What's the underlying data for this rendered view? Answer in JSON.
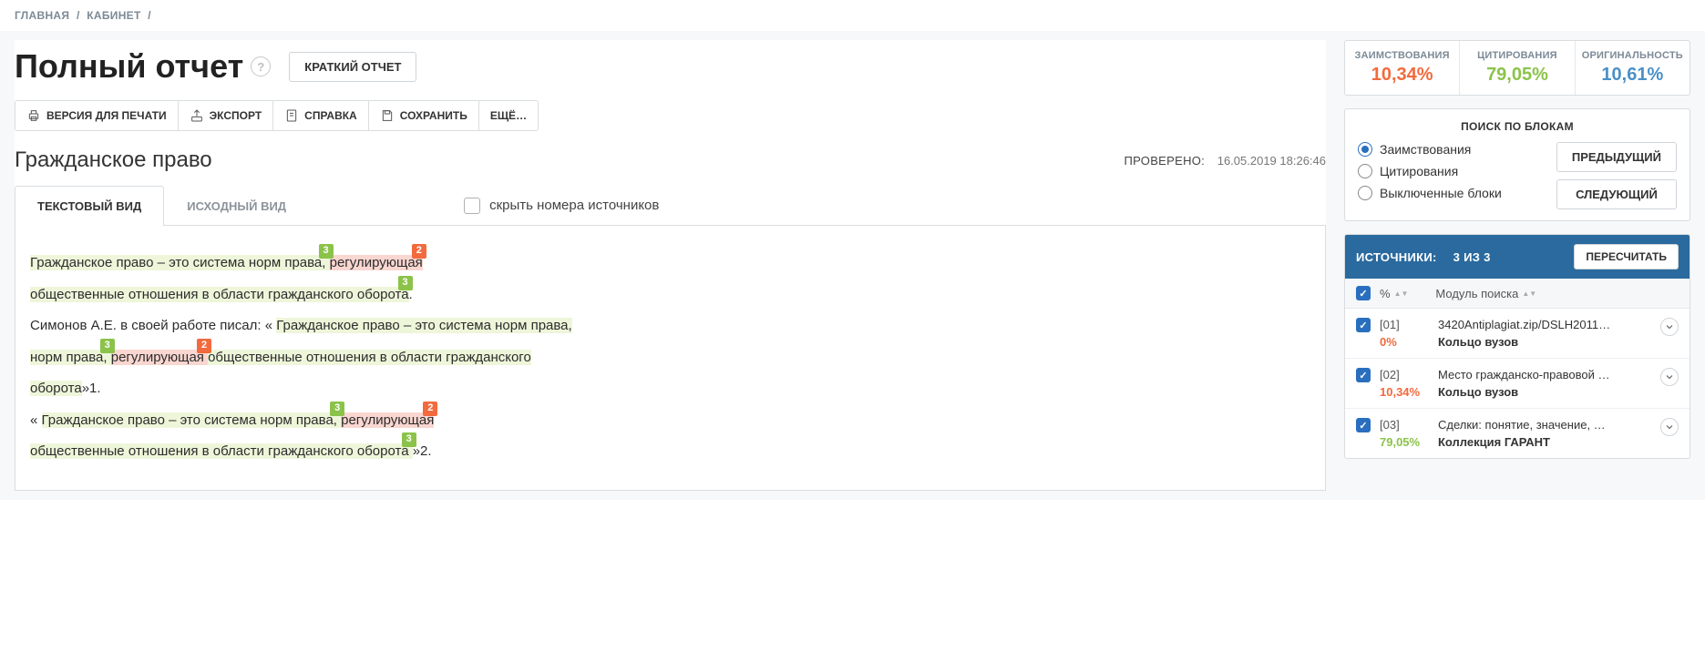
{
  "breadcrumb": {
    "home": "ГЛАВНАЯ",
    "cabinet": "КАБИНЕТ",
    "sep": "/"
  },
  "header": {
    "title": "Полный отчет",
    "short_report_btn": "КРАТКИЙ ОТЧЕТ"
  },
  "toolbar": {
    "print": "ВЕРСИЯ ДЛЯ ПЕЧАТИ",
    "export": "ЭКСПОРТ",
    "help": "СПРАВКА",
    "save": "СОХРАНИТЬ",
    "more": "ЕЩЁ…"
  },
  "doc": {
    "title": "Гражданское право",
    "checked_label": "ПРОВЕРЕНО:",
    "checked_ts": "16.05.2019 18:26:46"
  },
  "tabs": {
    "text_view": "ТЕКСТОВЫЙ ВИД",
    "source_view": "ИСХОДНЫЙ ВИД",
    "hide_src": "скрыть номера источников"
  },
  "body": {
    "p1a": "Гражданское право – это система норм права, ",
    "p1b": "регулирующая ",
    "p1c": "общественные отношения в области гражданского оборота",
    "p1d": ".",
    "p2a": "Симонов А.Е. в своей работе писал: « ",
    "p2b": "Гражданское право – это система норм права, ",
    "p2c": "регулирующая ",
    "p2d": "общественные отношения в области гражданского оборота",
    "p2e": "»1.",
    "p3a": "« ",
    "p3b": "Гражданское право – это система норм права, ",
    "p3c": "регулирующая ",
    "p3d": "общественные отношения в области гражданского оборота ",
    "p3e": "»2.",
    "tag2": "2",
    "tag3": "3"
  },
  "stats": {
    "borrow_label": "ЗАИМСТВОВАНИЯ",
    "borrow_val": "10,34%",
    "cite_label": "ЦИТИРОВАНИЯ",
    "cite_val": "79,05%",
    "orig_label": "ОРИГИНАЛЬНОСТЬ",
    "orig_val": "10,61%"
  },
  "blocksearch": {
    "title": "ПОИСК ПО БЛОКАМ",
    "r1": "Заимствования",
    "r2": "Цитирования",
    "r3": "Выключенные блоки",
    "prev": "ПРЕДЫДУЩИЙ",
    "next": "СЛЕДУЮЩИЙ"
  },
  "sources": {
    "head_label": "ИСТОЧНИКИ:",
    "head_count": "3 ИЗ 3",
    "recalc": "ПЕРЕСЧИТАТЬ",
    "col_pct": "%",
    "col_mod": "Модуль поиска",
    "items": [
      {
        "num": "[01]",
        "pct": "0%",
        "pct_class": "orange",
        "title": "3420Antiplagiat.zip/DSLH2011…",
        "mod": "Кольцо вузов"
      },
      {
        "num": "[02]",
        "pct": "10,34%",
        "pct_class": "orange",
        "title": "Место гражданско-правовой …",
        "mod": "Кольцо вузов"
      },
      {
        "num": "[03]",
        "pct": "79,05%",
        "pct_class": "green",
        "title": "Сделки: понятие, значение, …",
        "mod": "Коллекция ГАРАНТ"
      }
    ]
  }
}
